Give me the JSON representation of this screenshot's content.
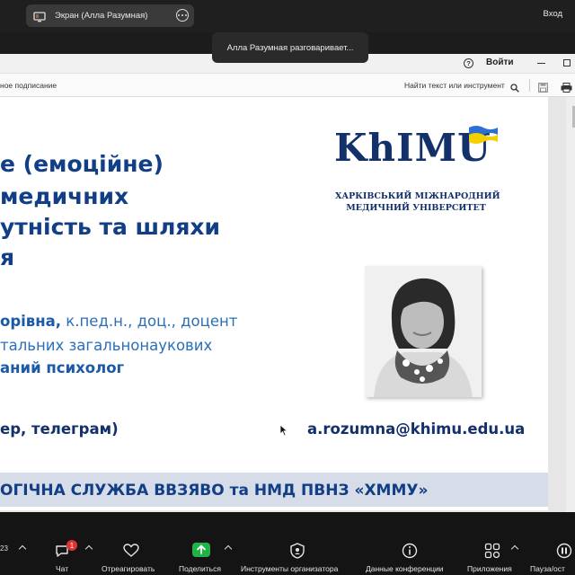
{
  "zoom": {
    "screen_title": "Экран (Алла Разумная)",
    "signin": "Вход",
    "talking_banner": "Алла Разумная разговаривает..."
  },
  "app": {
    "signin_button": "Войти",
    "sign_label": "ное подписание",
    "find_label": "Найти текст или инструмент"
  },
  "slide": {
    "title_lines": [
      "е (емоційне)",
      "медичних",
      "утність та шляхи",
      "я"
    ],
    "name": "орівна,",
    "degree": " к.пед.н., доц., доцент",
    "department": "тальних загальнонаукових",
    "role": "аний психолог",
    "contact": "ер, телеграм)",
    "email": "a.rozumna@khimu.edu.ua",
    "footer": "ОГІЧНА СЛУЖБА  ВВЗЯВО та НМД ПВНЗ «ХММУ»",
    "logo": {
      "wordmark": "KhIMU",
      "subtitle_line1": "ХАРКІВСЬКИЙ МІЖНАРОДНИЙ",
      "subtitle_line2": "МЕДИЧНИЙ УНІВЕРСИТЕТ"
    }
  },
  "toolbar": {
    "items": [
      {
        "label": "Чат",
        "icon": "chat-icon",
        "badge": "1"
      },
      {
        "label": "Отреагировать",
        "icon": "heart-icon"
      },
      {
        "label": "Поделиться",
        "icon": "share-screen-icon"
      },
      {
        "label": "Инструменты организатора",
        "icon": "shield-icon"
      },
      {
        "label": "Данные конференции",
        "icon": "info-icon"
      },
      {
        "label": "Приложения",
        "icon": "apps-icon"
      },
      {
        "label": "Пауза/ост",
        "icon": "pause-icon"
      }
    ],
    "left_count": "23"
  },
  "colors": {
    "title_blue": "#123e86",
    "share_green": "#1fb34a",
    "badge_red": "#e0332f"
  }
}
